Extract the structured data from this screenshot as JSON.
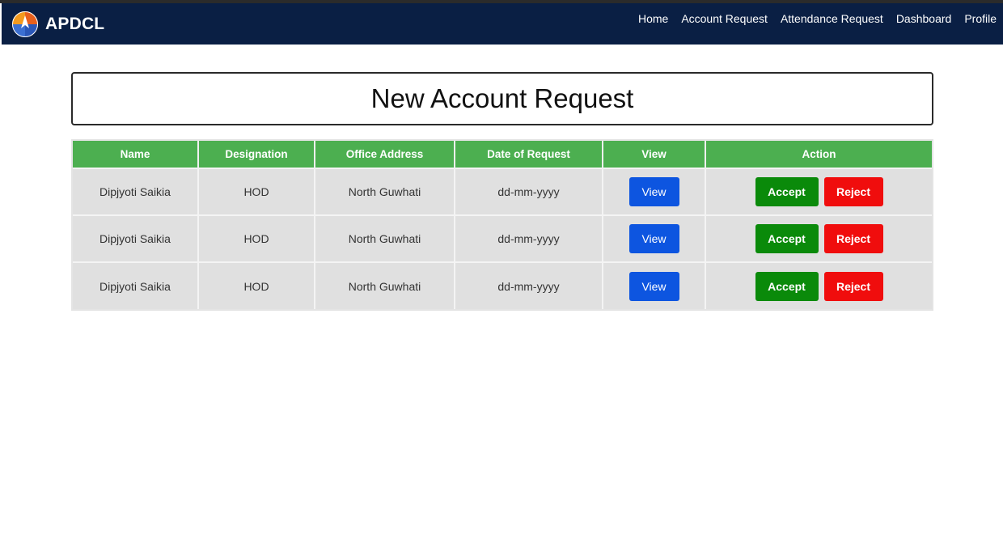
{
  "brand": {
    "name": "APDCL"
  },
  "nav": {
    "items": [
      "Home",
      "Account Request",
      "Attendance Request",
      "Dashboard",
      "Profile"
    ]
  },
  "page": {
    "title": "New Account Request"
  },
  "table": {
    "headers": [
      "Name",
      "Designation",
      "Office Address",
      "Date of Request",
      "View",
      "Action"
    ],
    "rows": [
      {
        "name": "Dipjyoti Saikia",
        "designation": "HOD",
        "office": "North Guwhati",
        "date": "dd-mm-yyyy",
        "view": "View",
        "accept": "Accept",
        "reject": "Reject"
      },
      {
        "name": "Dipjyoti Saikia",
        "designation": "HOD",
        "office": "North Guwhati",
        "date": "dd-mm-yyyy",
        "view": "View",
        "accept": "Accept",
        "reject": "Reject"
      },
      {
        "name": "Dipjyoti Saikia",
        "designation": "HOD",
        "office": "North Guwhati",
        "date": "dd-mm-yyyy",
        "view": "View",
        "accept": "Accept",
        "reject": "Reject"
      }
    ]
  },
  "colors": {
    "navbar": "#0a1f44",
    "header": "#4caf50",
    "view_button": "#0d55e0",
    "accept_button": "#0a8a0a",
    "reject_button": "#f00d0d"
  },
  "icons": {
    "logo": "apdcl-logo-icon"
  }
}
